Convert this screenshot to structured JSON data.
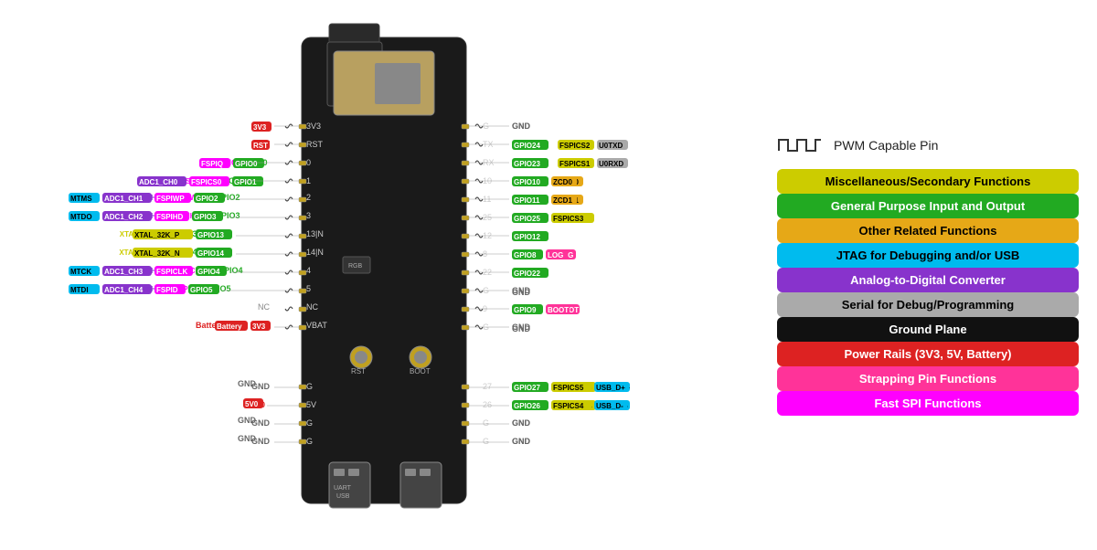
{
  "legend": {
    "pwm_label": "PWM Capable Pin",
    "items": [
      {
        "label": "Miscellaneous/Secondary Functions",
        "class": "legend-misc"
      },
      {
        "label": "General Purpose Input and Output",
        "class": "legend-gpio"
      },
      {
        "label": "Other Related Functions",
        "class": "legend-other"
      },
      {
        "label": "JTAG for Debugging and/or USB",
        "class": "legend-jtag"
      },
      {
        "label": "Analog-to-Digital Converter",
        "class": "legend-adc"
      },
      {
        "label": "Serial for Debug/Programming",
        "class": "legend-serial"
      },
      {
        "label": "Ground Plane",
        "class": "legend-gnd"
      },
      {
        "label": "Power Rails (3V3, 5V, Battery)",
        "class": "legend-power"
      },
      {
        "label": "Strapping Pin Functions",
        "class": "legend-strap"
      },
      {
        "label": "Fast SPI Functions",
        "class": "legend-spi"
      }
    ]
  }
}
